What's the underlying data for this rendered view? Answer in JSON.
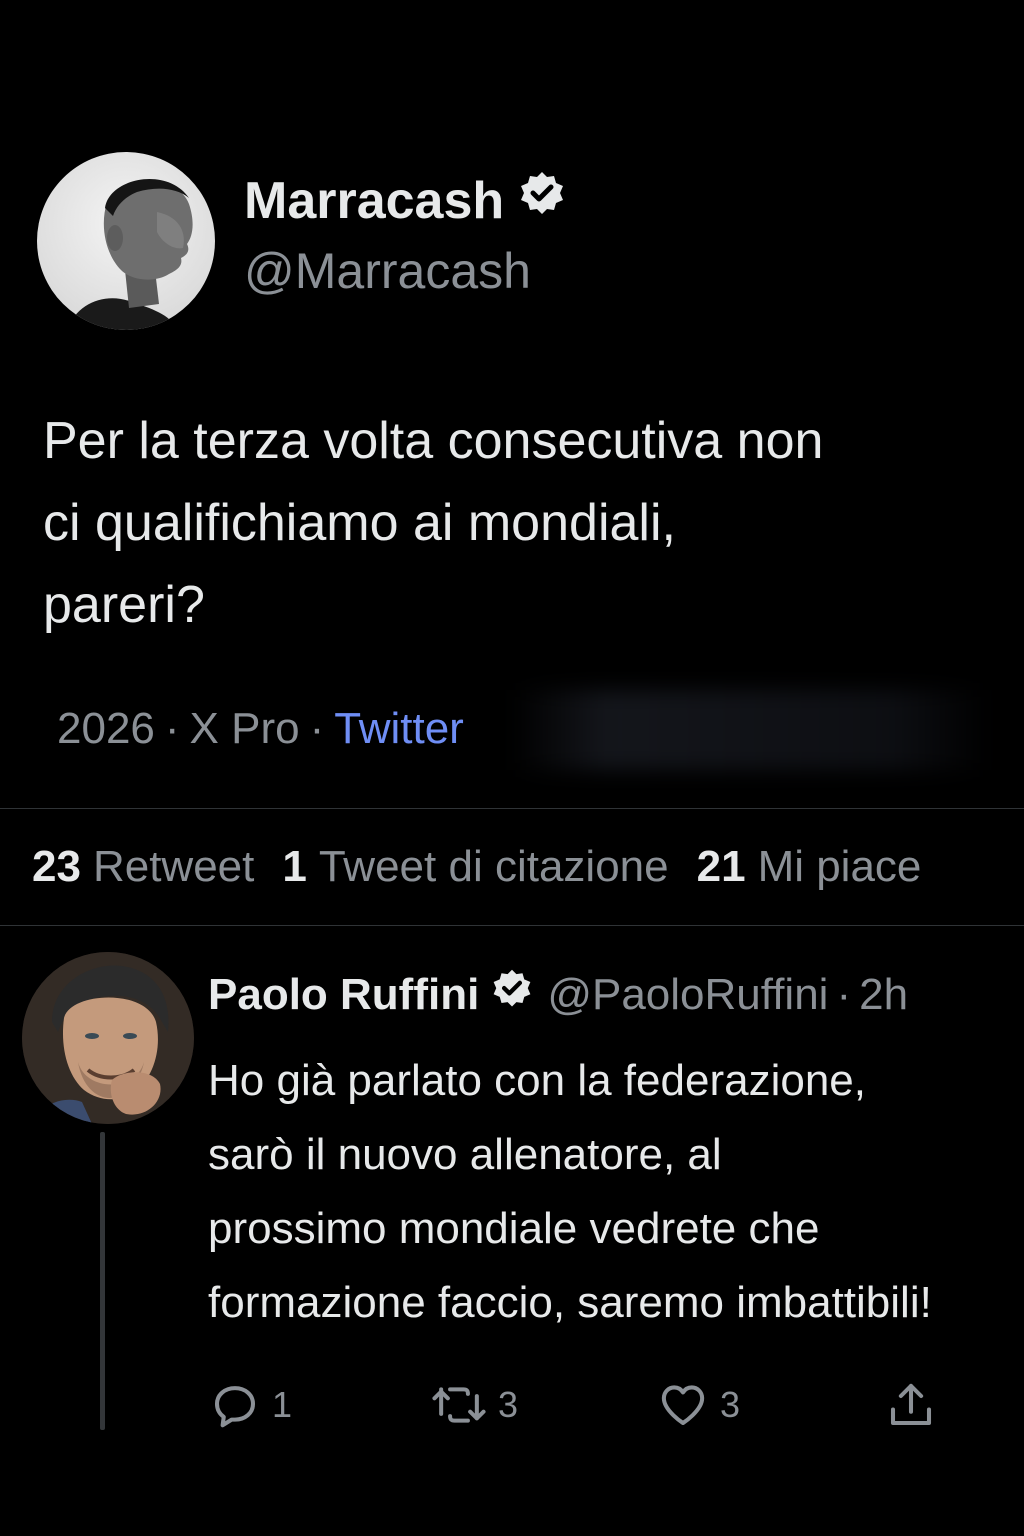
{
  "tweet": {
    "author_name": "Marracash",
    "author_handle": "@Marracash",
    "text_lines": [
      "Per la terza volta consecutiva non",
      "ci qualifichiamo ai mondiali,",
      "pareri?"
    ],
    "meta": {
      "year": "2026",
      "client": "X Pro",
      "sep": "·",
      "source": "Twitter"
    }
  },
  "stats": {
    "retweets_count": "23",
    "retweets_label": "Retweet",
    "quotes_count": "1",
    "quotes_label": "Tweet di citazione",
    "likes_count": "21",
    "likes_label": "Mi piace"
  },
  "reply": {
    "author_name": "Paolo Ruffini",
    "author_handle": "@PaoloRuffini",
    "sep": "·",
    "time": "2h",
    "text_lines": [
      "Ho già parlato con la federazione,",
      "sarò il nuovo allenatore, al",
      "prossimo mondiale vedrete che",
      "formazione faccio, saremo imbattibili!"
    ],
    "actions": {
      "reply_count": "1",
      "retweet_count": "3",
      "like_count": "3"
    }
  },
  "icons": {
    "verified": "verified-badge-icon",
    "reply": "reply-bubble-icon",
    "retweet": "retweet-icon",
    "like": "heart-icon",
    "share": "share-icon"
  },
  "colors": {
    "background": "#000000",
    "text_primary": "#e7e9ea",
    "text_secondary": "#8b9096",
    "link": "#6f8ef5",
    "divider": "#2f3336"
  }
}
